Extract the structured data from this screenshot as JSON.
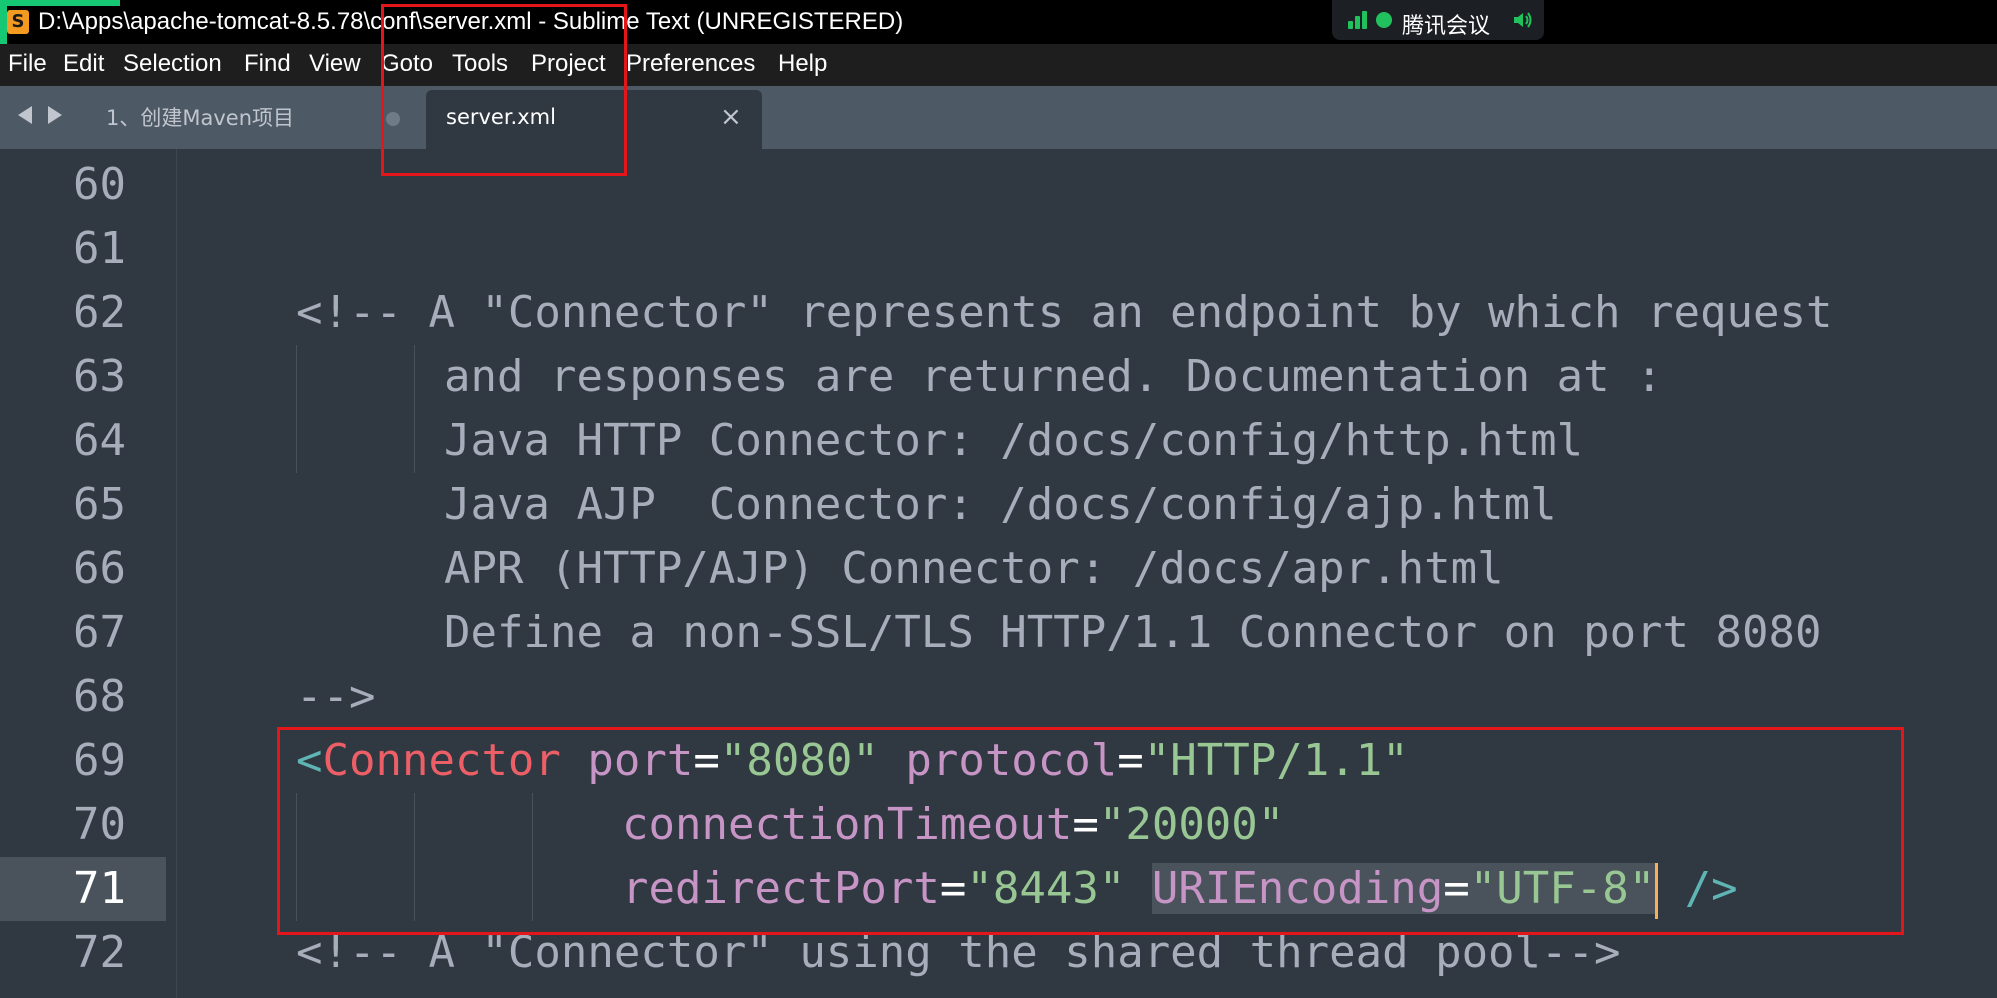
{
  "window": {
    "title": "D:\\Apps\\apache-tomcat-8.5.78\\conf\\server.xml - Sublime Text (UNREGISTERED)",
    "app_icon_glyph": "S"
  },
  "meeting_overlay": {
    "label": "腾讯会议"
  },
  "menu": {
    "items": [
      "File",
      "Edit",
      "Selection",
      "Find",
      "View",
      "Goto",
      "Tools",
      "Project",
      "Preferences",
      "Help"
    ]
  },
  "tabs": {
    "inactive_label": "1、创建Maven项目",
    "active_label": "server.xml",
    "close_glyph": "×"
  },
  "editor": {
    "line_numbers": [
      "60",
      "61",
      "62",
      "63",
      "64",
      "65",
      "66",
      "67",
      "68",
      "69",
      "70",
      "71",
      "72"
    ],
    "active_line": "71",
    "lines": {
      "l60": "",
      "l61": "",
      "l62": "<!-- A \"Connector\" represents an endpoint by which request",
      "l63": "and responses are returned. Documentation at :",
      "l64": "Java HTTP Connector: /docs/config/http.html",
      "l65": "Java AJP  Connector: /docs/config/ajp.html",
      "l66": "APR (HTTP/AJP) Connector: /docs/apr.html",
      "l67": "Define a non-SSL/TLS HTTP/1.1 Connector on port 8080",
      "l68": "-->",
      "l72": "<!-- A \"Connector\" using the shared thread pool-->"
    },
    "connector": {
      "open": "<",
      "tag": "Connector",
      "port_attr": "port",
      "port_val": "\"8080\"",
      "protocol_attr": "protocol",
      "protocol_val": "\"HTTP/1.1\"",
      "timeout_attr": "connectionTimeout",
      "timeout_val": "\"20000\"",
      "redirect_attr": "redirectPort",
      "redirect_val": "\"8443\"",
      "uri_attr": "URIEncoding",
      "uri_val": "\"UTF-8\"",
      "eq": "=",
      "close": "/>"
    }
  },
  "colors": {
    "editor_bg": "#303841",
    "tag": "#ec5f66",
    "attribute": "#c695c6",
    "string": "#99c794",
    "punctuation": "#5fb4b4",
    "annotation_box": "#e3161c",
    "cursor": "#f9ae58"
  }
}
